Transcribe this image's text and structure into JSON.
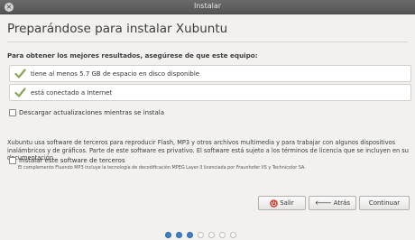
{
  "window": {
    "title": "Instalar"
  },
  "page": {
    "heading": "Preparándose para instalar Xubuntu",
    "intro": "Para obtener los mejores resultados, asegúrese de que este equipo:",
    "requirements": [
      {
        "label": "tiene al menos 5.7 GB de espacio en disco disponible",
        "met": true
      },
      {
        "label": "está conectado a Internet",
        "met": true
      }
    ],
    "download_updates": {
      "label": "Descargar actualizaciones mientras se instala",
      "checked": false
    },
    "third_party_description": "Xubuntu usa software de terceros para reproducir Flash, MP3 y otros archivos multimedia y para trabajar con algunos dispositivos inalámbricos y de gráficos. Parte de este software es privativo. El software está sujeto a los términos de licencia que se incluyen en su documentación.",
    "third_party": {
      "label": "Instalar este software de terceros",
      "checked": false
    },
    "third_party_note": "El complemento Fluendo MP3 incluye la tecnología de decodificación MPEG Layer-3 licenciada por Fraunhofer IIS y Technicolor SA."
  },
  "buttons": {
    "quit": "Salir",
    "back": "Atrás",
    "continue": "Continuar"
  },
  "progress": {
    "total_steps": 7,
    "current_step": 3
  },
  "colors": {
    "check_green": "#87a556",
    "dot_active": "#3b80c9",
    "dot_inactive": "#ffffff",
    "quit_icon": "#d23a2d"
  }
}
